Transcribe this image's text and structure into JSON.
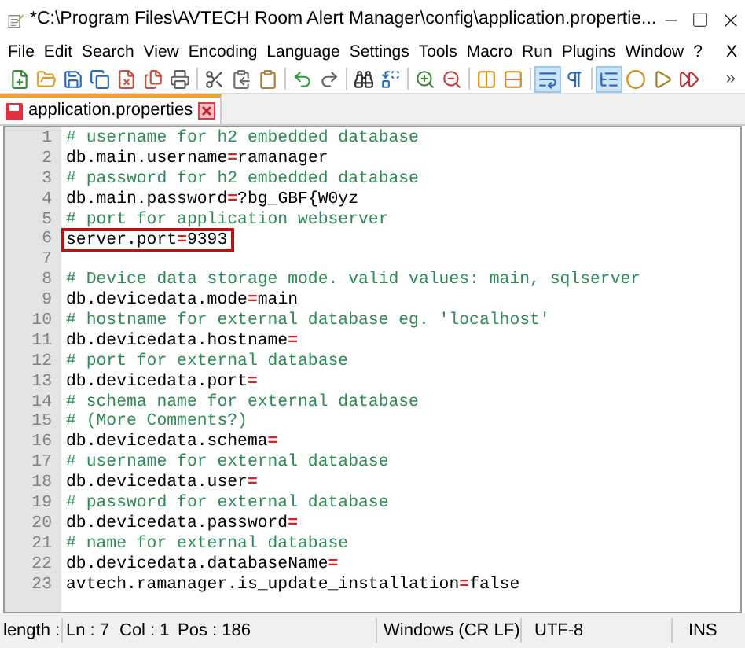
{
  "window": {
    "title": "*C:\\Program Files\\AVTECH Room Alert Manager\\config\\application.propertie..."
  },
  "menu": {
    "items": [
      "File",
      "Edit",
      "Search",
      "View",
      "Encoding",
      "Language",
      "Settings",
      "Tools",
      "Macro",
      "Run",
      "Plugins",
      "Window",
      "?"
    ],
    "close_label": "X"
  },
  "toolbar": {
    "buttons": [
      {
        "selected": false
      },
      {
        "selected": false
      },
      {
        "selected": false
      },
      {
        "selected": false
      },
      {
        "selected": false
      },
      {
        "selected": false
      },
      {
        "selected": false
      },
      {
        "selected": false
      },
      {
        "selected": false
      },
      {
        "selected": false
      },
      {
        "selected": false
      },
      {
        "selected": false
      },
      {
        "selected": false
      },
      {
        "selected": false
      },
      {
        "selected": false
      },
      {
        "selected": false
      },
      {
        "selected": false
      },
      {
        "selected": false
      },
      {
        "selected": true
      },
      {
        "selected": false
      },
      {
        "selected": true
      },
      {
        "selected": false
      },
      {
        "selected": false
      },
      {
        "selected": false
      }
    ],
    "overflow": "»"
  },
  "tabs": [
    {
      "label": "application.properties",
      "selected": true,
      "modified": true
    }
  ],
  "editor": {
    "lines": [
      {
        "number": "1",
        "kind": "comment",
        "text": "# username for h2 embedded database",
        "highlighted": false
      },
      {
        "number": "2",
        "kind": "property",
        "key": "db.main.username",
        "separator": "=",
        "value": "ramanager",
        "highlighted": false
      },
      {
        "number": "3",
        "kind": "comment",
        "text": "# password for h2 embedded database",
        "highlighted": false
      },
      {
        "number": "4",
        "kind": "property",
        "key": "db.main.password",
        "separator": "=",
        "value": "?bg_GBF{W0yz",
        "highlighted": false
      },
      {
        "number": "5",
        "kind": "comment",
        "text": "# port for application webserver",
        "highlighted": false
      },
      {
        "number": "6",
        "kind": "property",
        "key": "server.port",
        "separator": "=",
        "value": "9393",
        "highlighted": true
      },
      {
        "number": "7",
        "kind": "blank",
        "highlighted": false
      },
      {
        "number": "8",
        "kind": "comment",
        "text": "# Device data storage mode. valid values: main, sqlserver",
        "highlighted": false
      },
      {
        "number": "9",
        "kind": "property",
        "key": "db.devicedata.mode",
        "separator": "=",
        "value": "main",
        "highlighted": false
      },
      {
        "number": "10",
        "kind": "comment",
        "text": "# hostname for external database eg. 'localhost'",
        "highlighted": false
      },
      {
        "number": "11",
        "kind": "property",
        "key": "db.devicedata.hostname",
        "separator": "=",
        "highlighted": false
      },
      {
        "number": "12",
        "kind": "comment",
        "text": "# port for external database",
        "highlighted": false
      },
      {
        "number": "13",
        "kind": "property",
        "key": "db.devicedata.port",
        "separator": "=",
        "highlighted": false
      },
      {
        "number": "14",
        "kind": "comment",
        "text": "# schema name for external database",
        "highlighted": false
      },
      {
        "number": "15",
        "kind": "comment",
        "text": "# (More Comments?)",
        "highlighted": false
      },
      {
        "number": "16",
        "kind": "property",
        "key": "db.devicedata.schema",
        "separator": "=",
        "highlighted": false
      },
      {
        "number": "17",
        "kind": "comment",
        "text": "# username for external database",
        "highlighted": false
      },
      {
        "number": "18",
        "kind": "property",
        "key": "db.devicedata.user",
        "separator": "=",
        "highlighted": false
      },
      {
        "number": "19",
        "kind": "comment",
        "text": "# password for external database",
        "highlighted": false
      },
      {
        "number": "20",
        "kind": "property",
        "key": "db.devicedata.password",
        "separator": "=",
        "highlighted": false
      },
      {
        "number": "21",
        "kind": "comment",
        "text": "# name for external database",
        "highlighted": false
      },
      {
        "number": "22",
        "kind": "property",
        "key": "db.devicedata.databaseName",
        "separator": "=",
        "highlighted": false
      },
      {
        "number": "23",
        "kind": "property",
        "key": "avtech.ramanager.is_update_installation",
        "separator": "=",
        "value": "false",
        "highlighted": false
      }
    ]
  },
  "status_bar": {
    "length": "length :",
    "line": "Ln : 7",
    "column": "Col : 1",
    "position": "Pos : 186",
    "eol": "Windows (CR LF)",
    "encoding": "UTF-8",
    "mode": "INS"
  }
}
